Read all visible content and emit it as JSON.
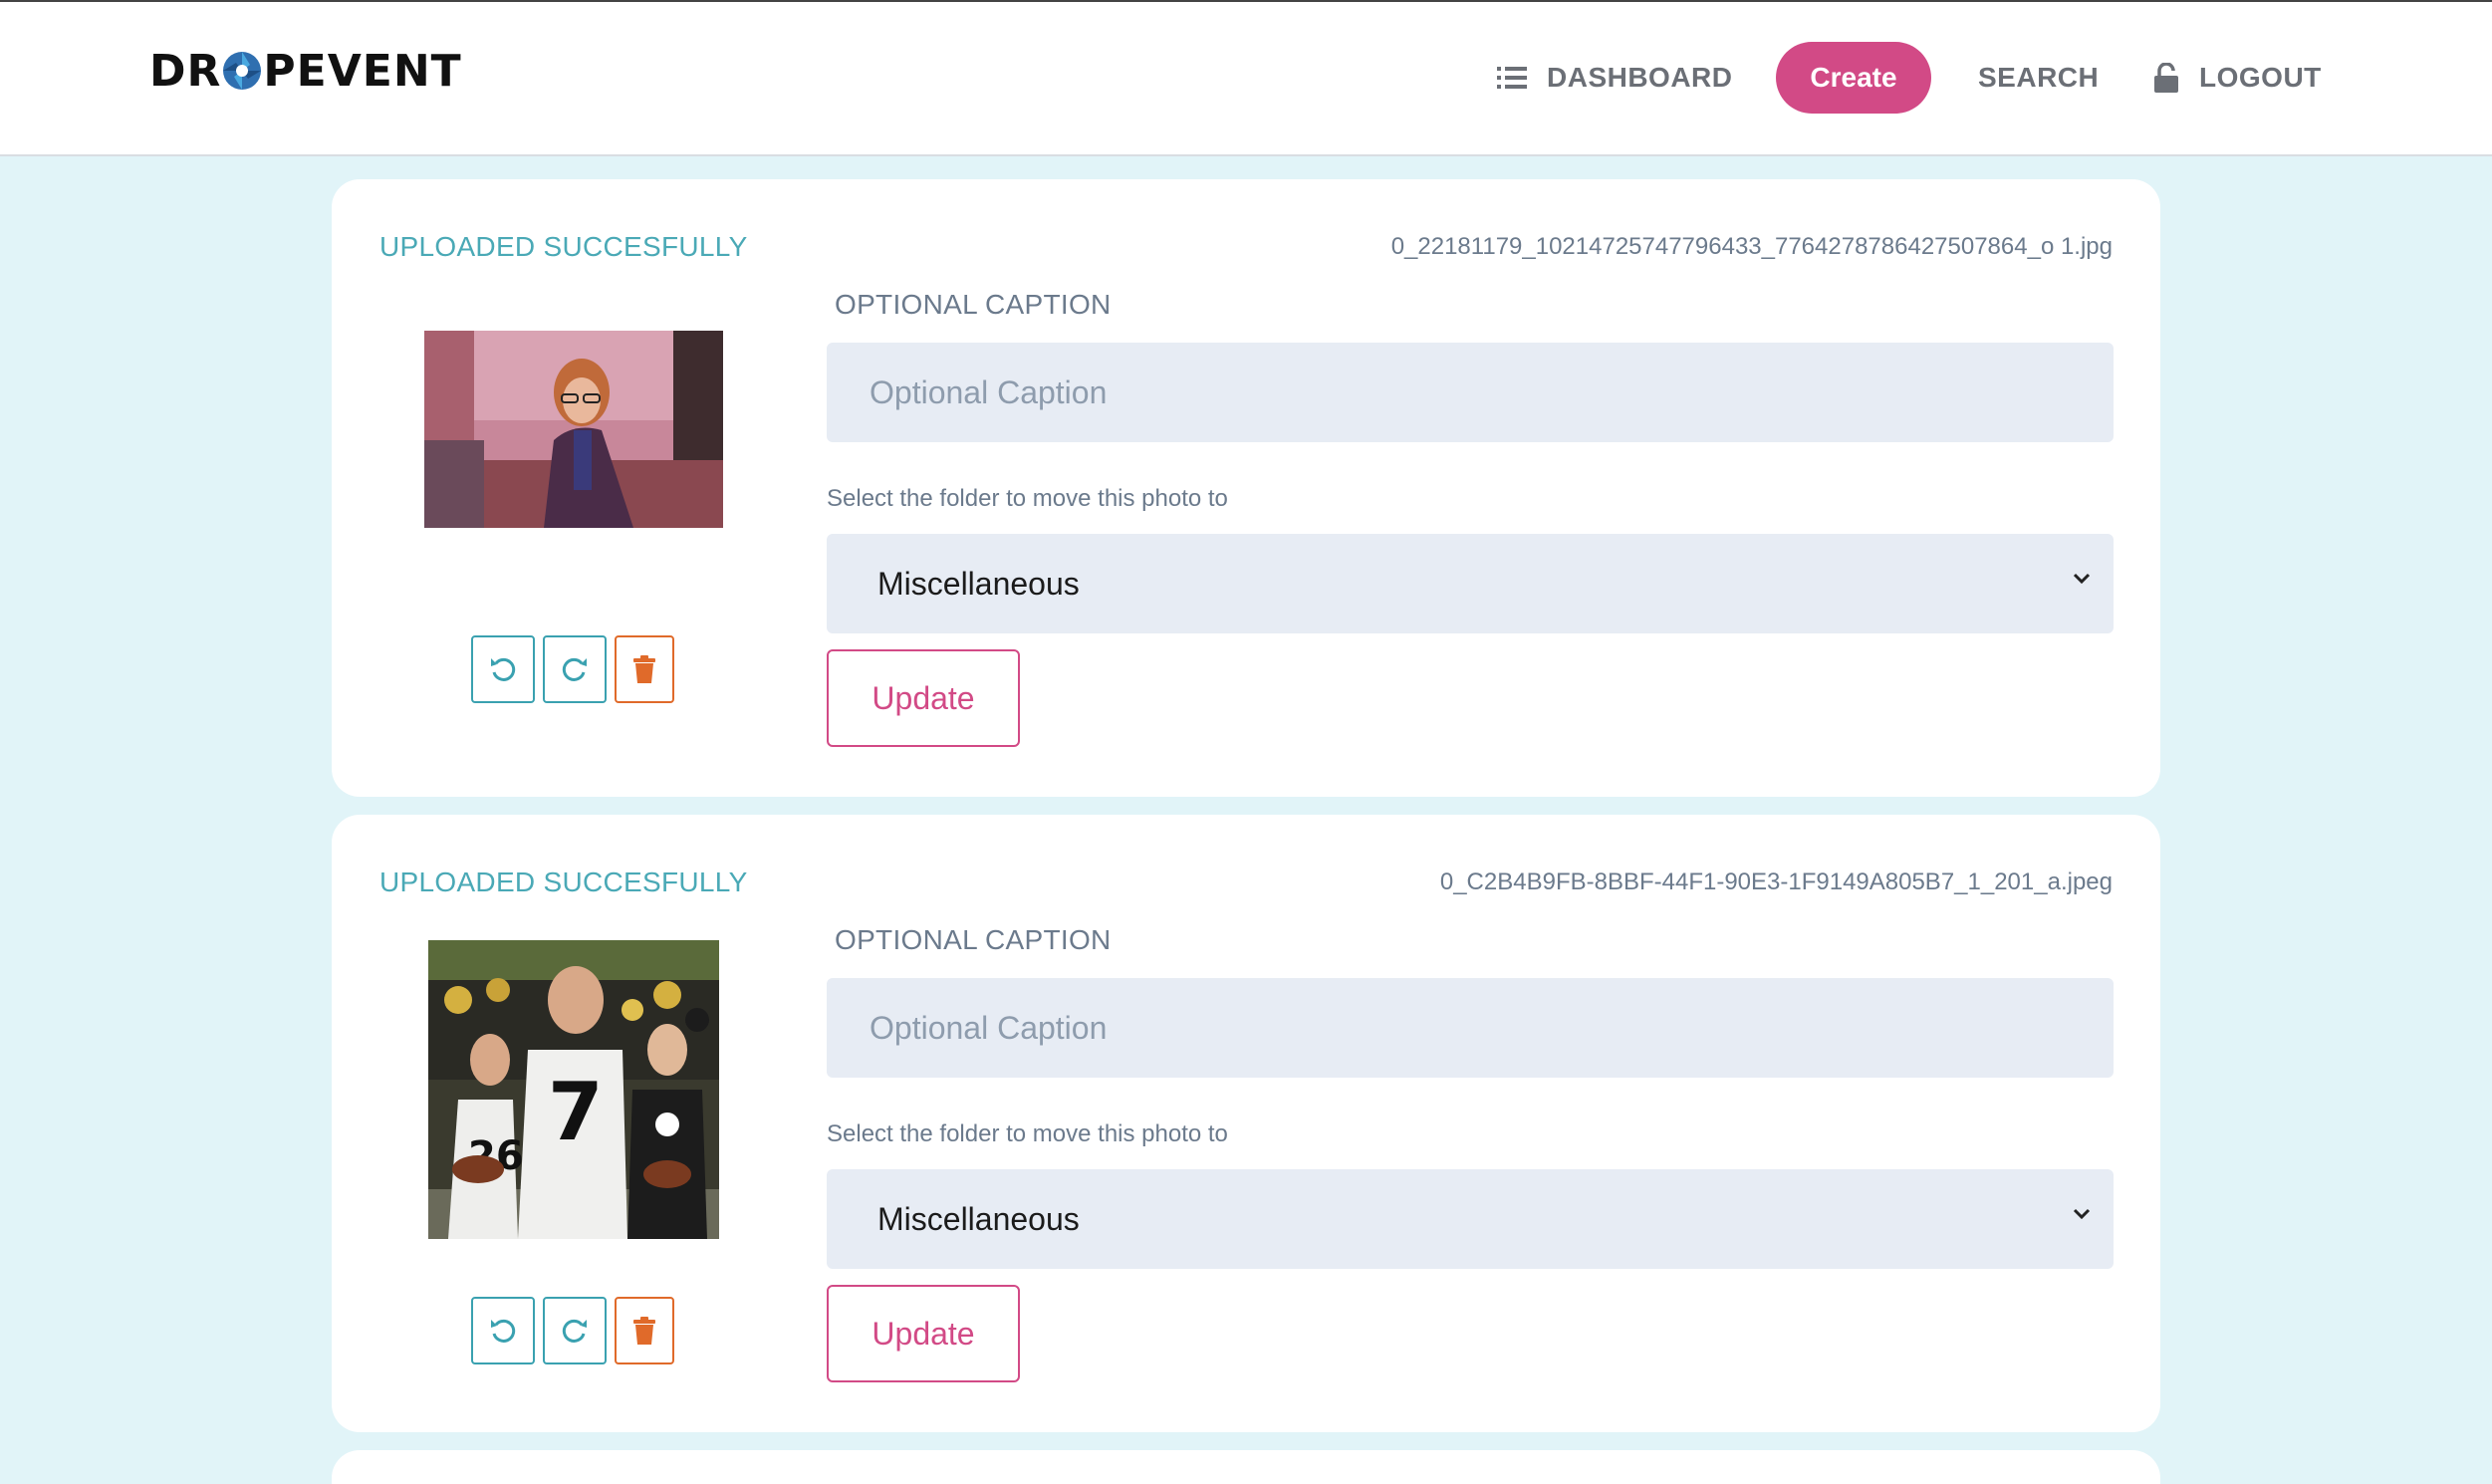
{
  "brand": {
    "logo_left": "DR",
    "logo_right": "PEVENT"
  },
  "nav": {
    "dashboard": "DASHBOARD",
    "create": "Create",
    "search": "SEARCH",
    "logout": "LOGOUT"
  },
  "colors": {
    "accent_pink": "#d24a86",
    "status_teal": "#4aa9b6",
    "page_bg": "#e1f4f8",
    "delete_orange": "#e06a2a"
  },
  "uploads": [
    {
      "status": "UPLOADED SUCCESFULLY",
      "filename": "0_22181179_10214725747796433_7764278786427507864_o 1.jpg",
      "caption_label": "OPTIONAL CAPTION",
      "caption_value": "",
      "caption_placeholder": "Optional Caption",
      "folder_label": "Select the folder to move this photo to",
      "folder_selected": "Miscellaneous",
      "update_label": "Update"
    },
    {
      "status": "UPLOADED SUCCESFULLY",
      "filename": "0_C2B4B9FB-8BBF-44F1-90E3-1F9149A805B7_1_201_a.jpeg",
      "caption_label": "OPTIONAL CAPTION",
      "caption_value": "",
      "caption_placeholder": "Optional Caption",
      "folder_label": "Select the folder to move this photo to",
      "folder_selected": "Miscellaneous",
      "update_label": "Update"
    }
  ],
  "icons": {
    "rotate_left": "rotate-left-icon",
    "rotate_right": "rotate-right-icon",
    "delete": "trash-icon",
    "list": "list-icon",
    "lock": "lock-icon",
    "chevron": "chevron-down-icon"
  }
}
